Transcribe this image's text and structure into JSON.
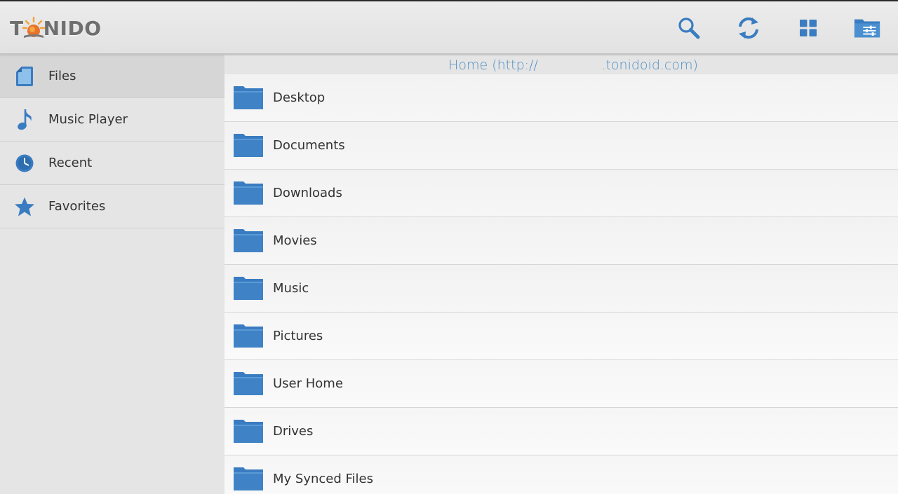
{
  "app": {
    "logo_text_before": "T",
    "logo_text_after": "NIDO"
  },
  "toolbar": {
    "icons": [
      "search-icon",
      "refresh-icon",
      "grid-view-icon",
      "folder-settings-icon"
    ]
  },
  "sidebar": {
    "items": [
      {
        "label": "Files",
        "icon": "files-icon",
        "active": true
      },
      {
        "label": "Music Player",
        "icon": "music-note-icon",
        "active": false
      },
      {
        "label": "Recent",
        "icon": "clock-icon",
        "active": false
      },
      {
        "label": "Favorites",
        "icon": "star-icon",
        "active": false
      }
    ]
  },
  "path": {
    "text": "Home (http://               .tonidoid.com)"
  },
  "files": [
    {
      "name": "Desktop",
      "icon": "folder-icon"
    },
    {
      "name": "Documents",
      "icon": "folder-icon"
    },
    {
      "name": "Downloads",
      "icon": "folder-icon"
    },
    {
      "name": "Movies",
      "icon": "folder-icon"
    },
    {
      "name": "Music",
      "icon": "folder-icon"
    },
    {
      "name": "Pictures",
      "icon": "folder-icon"
    },
    {
      "name": "User Home",
      "icon": "folder-icon"
    },
    {
      "name": "Drives",
      "icon": "folder-icon"
    },
    {
      "name": "My Synced Files",
      "icon": "folder-icon"
    }
  ],
  "colors": {
    "accent": "#3a7cc1",
    "path_text": "#4f8fc4"
  }
}
